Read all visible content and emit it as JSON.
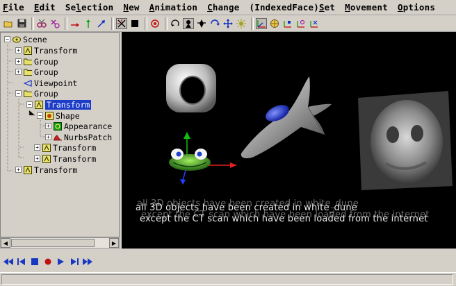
{
  "menu": {
    "items": [
      {
        "pre": "",
        "mn": "F",
        "post": "ile"
      },
      {
        "pre": "",
        "mn": "E",
        "post": "dit"
      },
      {
        "pre": "Se",
        "mn": "l",
        "post": "ection"
      },
      {
        "pre": "",
        "mn": "N",
        "post": "ew"
      },
      {
        "pre": "",
        "mn": "A",
        "post": "nimation"
      },
      {
        "pre": "",
        "mn": "C",
        "post": "hange"
      },
      {
        "pre": "(IndexedFace)",
        "mn": "S",
        "post": "et"
      },
      {
        "pre": "",
        "mn": "M",
        "post": "ovement"
      },
      {
        "pre": "",
        "mn": "O",
        "post": "ptions"
      }
    ]
  },
  "tree": {
    "nodes": [
      {
        "label": "Scene",
        "icon": "scene-icon",
        "expander": "−"
      },
      {
        "label": "Transform",
        "icon": "transform-icon",
        "expander": "+"
      },
      {
        "label": "Group",
        "icon": "group-icon",
        "expander": "+"
      },
      {
        "label": "Group",
        "icon": "group-icon",
        "expander": "+"
      },
      {
        "label": "Viewpoint",
        "icon": "viewpoint-icon",
        "expander": ""
      },
      {
        "label": "Group",
        "icon": "group-icon",
        "expander": "−"
      },
      {
        "label": "Transform",
        "icon": "transform-icon",
        "expander": "−"
      },
      {
        "label": "Shape",
        "icon": "shape-icon",
        "expander": "−"
      },
      {
        "label": "Appearance",
        "icon": "appearance-icon",
        "expander": "+"
      },
      {
        "label": "NurbsPatch",
        "icon": "nurbs-icon",
        "expander": "+"
      },
      {
        "label": "Transform",
        "icon": "transform-icon",
        "expander": "+"
      },
      {
        "label": "Transform",
        "icon": "transform-icon",
        "expander": "+"
      },
      {
        "label": "Transform",
        "icon": "transform-icon",
        "expander": "+"
      }
    ]
  },
  "viewport": {
    "caption_line1": "all 3D objects have been created in white_dune",
    "caption_line2": "except the CT scan which have been loaded from the internet"
  },
  "colors": {
    "selection": "#1c3cc8",
    "player": "#1838c0",
    "record": "#c01010"
  }
}
